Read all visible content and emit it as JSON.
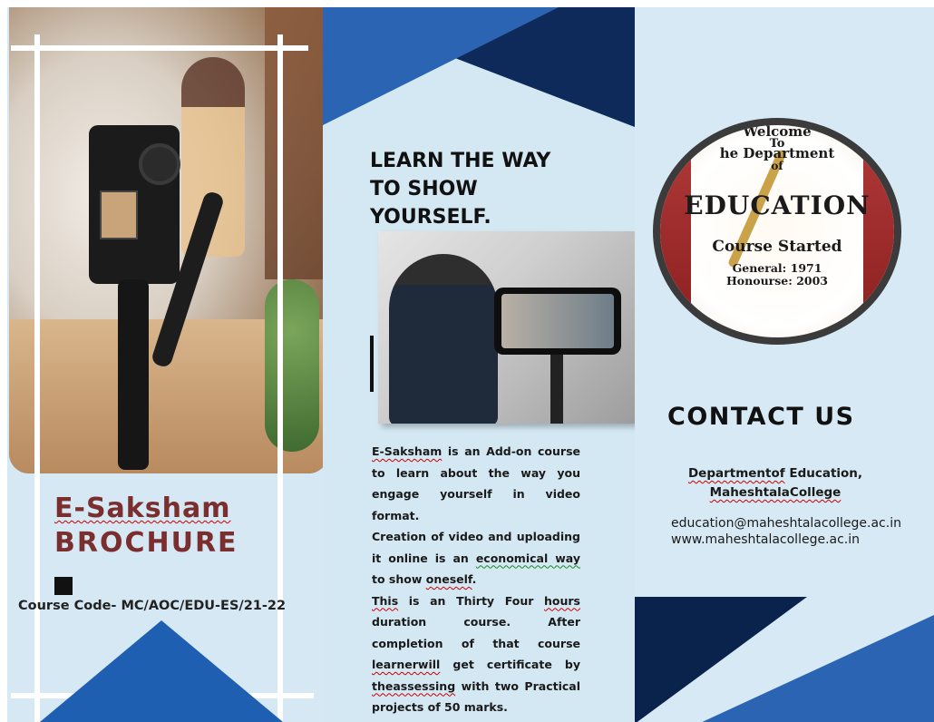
{
  "left_panel": {
    "title_line1": "E-Saksham",
    "title_line2": "BROCHURE",
    "course_code": "Course Code- MC/AOC/EDU-ES/21-22"
  },
  "middle_panel": {
    "headline": "LEARN THE WAY TO SHOW YOURSELF.",
    "para1_a": "E-Saksham",
    "para1_b": " is an Add-on course to learn about the way you engage yourself in video format.",
    "para2_a": "Creation of video and uploading it online is an ",
    "para2_b": "economical way",
    "para2_c": " to show ",
    "para2_d": "oneself",
    "para2_e": ".",
    "para3_a": "This",
    "para3_b": " is an Thirty Four ",
    "para3_c": "hours",
    "para3_d": " duration course. After completion of that course ",
    "para3_e": "learnerwill",
    "para3_f": " get certificate by ",
    "para3_g": "theassessing",
    "para3_h": " with two Practical projects of 50 marks."
  },
  "right_panel": {
    "seal": {
      "line1": "Welcome",
      "line2": "To",
      "line3": "he Department",
      "line4": "of",
      "line5": "EDUCATION",
      "line6": "Course Started",
      "line7": "General: 1971",
      "line8": "Honourse: 2003"
    },
    "contact_title": "CONTACT  US",
    "dept_line1_a": "Departmentof",
    "dept_line1_b": " Education,",
    "dept_line2": "MaheshtalaCollege",
    "email": "education@maheshtalacollege.ac.in",
    "website": "www.maheshtalacollege.ac.in"
  },
  "colors": {
    "navy": "#0d2a5b",
    "blue": "#2c64b4",
    "light_bg": "#d5e8f3",
    "title_red": "#7a2e2e"
  }
}
